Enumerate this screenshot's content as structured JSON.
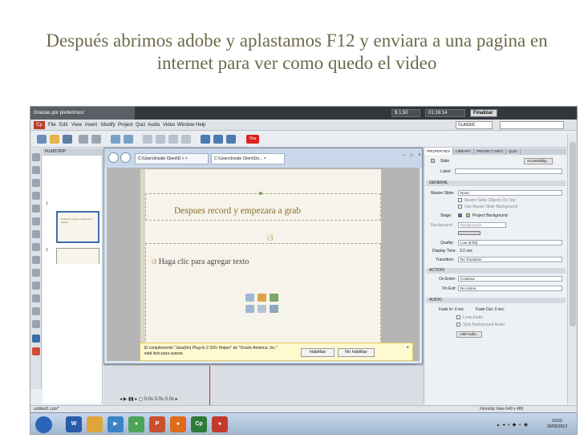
{
  "slide": {
    "title": "Después abrimos adobe y aplastamos F12 y enviara a una pagina en internet para ver como quedo el video",
    "ornament": "ଓ"
  },
  "app": {
    "toast": "Gracias por preferirnos!",
    "counter1": "$ 1,50",
    "counter2": "01:16:14",
    "finish_label": "Finalizar",
    "menu": [
      "File",
      "Edit",
      "View",
      "Insert",
      "Modify",
      "Project",
      "Quiz",
      "Audio",
      "Video",
      "Window",
      "Help"
    ],
    "logo": "Cp",
    "workspace": "CLASSIC",
    "youtube": "You Tube",
    "filmstrip_title": "FILMSTRIP",
    "slide_nums": [
      "1",
      "2"
    ],
    "thumb_text": "Despues record y empezar a grabar"
  },
  "browser": {
    "tab1": "C:\\Users\\Inside Client\\D ˅ ×",
    "tab2": "C:\\Users\\Inside Client\\Do... ×",
    "slide_heading": "Despues record y empezara a grab",
    "body_text": "Haga clic para agregar texto",
    "bullet": "ଓ"
  },
  "notification": {
    "message": "El complemento \"Java(tm) Plug-In 2 SSV Helper\" de \"Oracle America, Inc.\" está listo para usarse.",
    "enable": "Habilitar",
    "disable": "No habilitar",
    "close": "×"
  },
  "timeline": {
    "controls": "◂  ▶  ▮▮  ▸  ◻  0.0s    0.0s    0.0s    ▸"
  },
  "properties": {
    "tabs": [
      "PROPERTIES",
      "LIBRARY",
      "PROJECT INFO",
      "QUIZ"
    ],
    "slide_label": "Slide",
    "accessibility": "Accessibility...",
    "label_caption": "Label:",
    "general": "GENERAL",
    "master_slide_label": "Master Slide:",
    "master_slide_value": "None",
    "check1": "Master Slide Objects On Top",
    "check2": "Use Master Slide Background",
    "stage_label": "Stage:",
    "project_bg": "Project Background",
    "background_label": "Background:",
    "background_value": "Background1",
    "quality_label": "Quality:",
    "quality_value": "Low (8-bit)",
    "display_time_label": "Display Time:",
    "display_time_value": "3.0 sec",
    "transition_label": "Transition:",
    "transition_value": "No Transition",
    "action": "ACTION",
    "on_enter_label": "On Enter:",
    "on_enter_value": "Continue",
    "on_exit_label": "On Exit:",
    "on_exit_value": "No Action",
    "audio": "AUDIO",
    "fade_in": "Fade In: 0 sec",
    "fade_out": "Fade Out: 0 sec",
    "loop_audio": "Loop Audio",
    "stop_bg_audio": "Stop Background Audio",
    "add_audio": "Add Audio..."
  },
  "status": {
    "left": "untitled1.cptx*",
    "right": "Filmstrip View     640 x 480"
  },
  "taskbar": {
    "apps": [
      {
        "label": "",
        "color": "#2a66b8"
      },
      {
        "label": "W",
        "color": "#2a5ba8"
      },
      {
        "label": "",
        "color": "#e0a53a"
      },
      {
        "label": "▶",
        "color": "#3c82c4"
      },
      {
        "label": "●",
        "color": "#4aa45a"
      },
      {
        "label": "P",
        "color": "#c9512e"
      },
      {
        "label": "●",
        "color": "#e06a1c"
      },
      {
        "label": "Cp",
        "color": "#2d7a3a"
      },
      {
        "label": "●",
        "color": "#c33a2c"
      }
    ],
    "clock_time": "19:52",
    "clock_date": "30/05/2012",
    "tray": "▴ ◂ ▪ ◆ ▪ ◉"
  }
}
